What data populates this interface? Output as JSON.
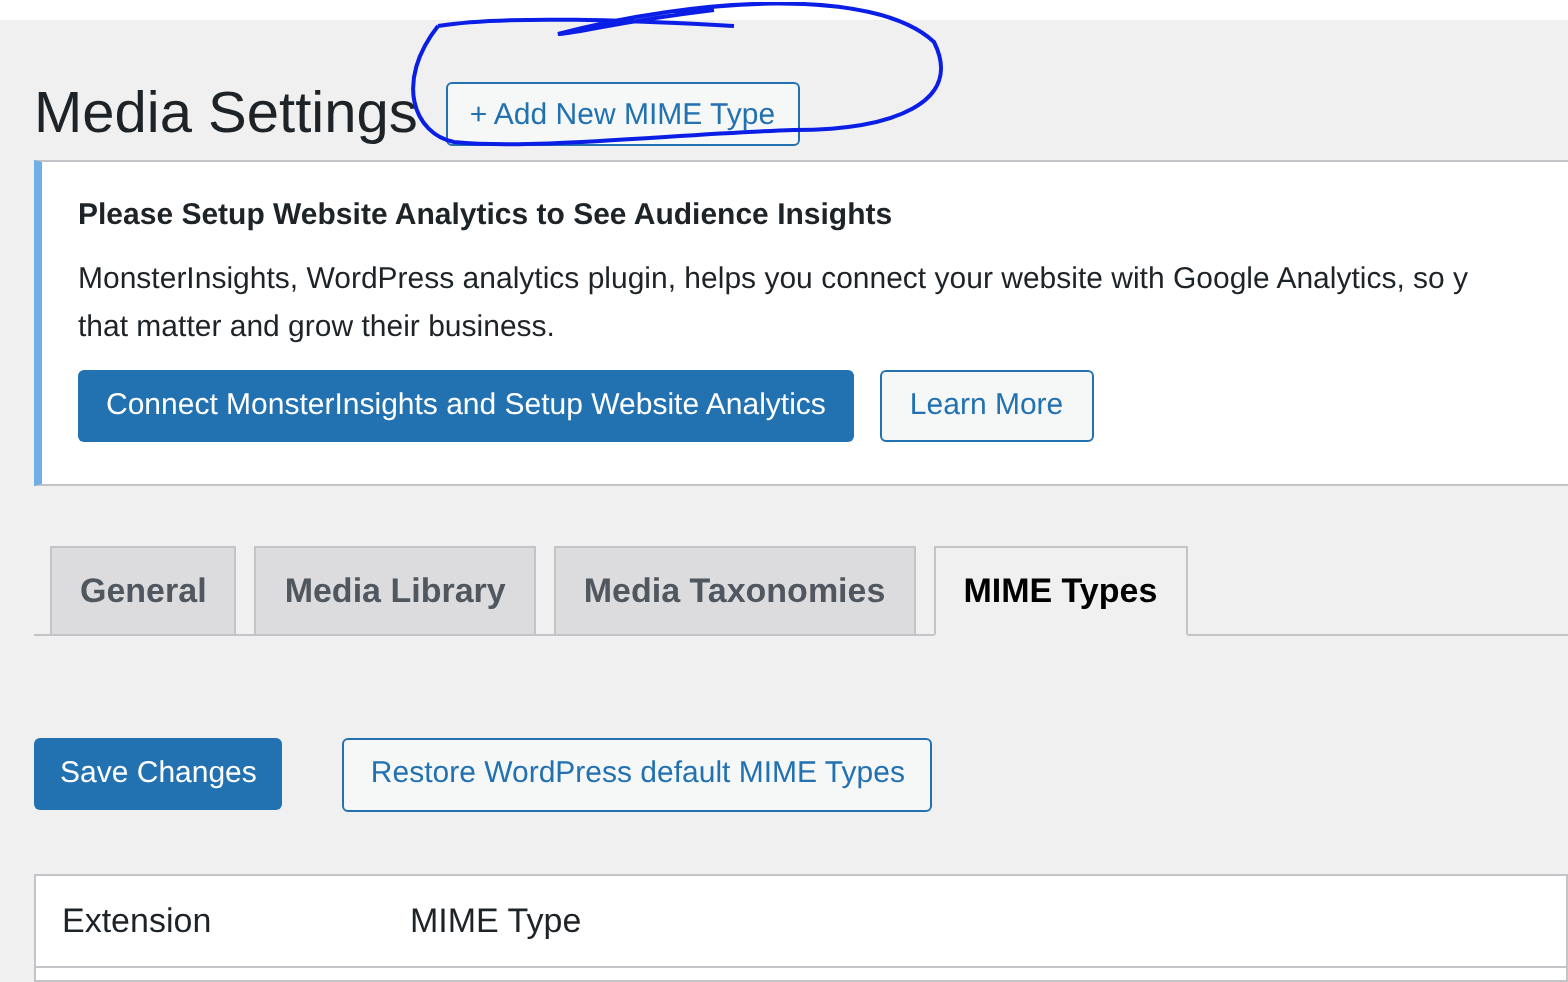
{
  "page_title": "Media Settings",
  "add_button": {
    "label": "+ Add New MIME Type",
    "circled": true
  },
  "notice": {
    "title": "Please Setup Website Analytics to See Audience Insights",
    "text": "MonsterInsights, WordPress analytics plugin, helps you connect your website with Google Analytics, so y",
    "text_line_2": "that matter and grow their business.",
    "primary_button": "Connect MonsterInsights and Setup Website Analytics",
    "secondary_button": "Learn More"
  },
  "tabs": [
    {
      "label": "General",
      "selected": false
    },
    {
      "label": "Media Library",
      "selected": false
    },
    {
      "label": "Media Taxonomies",
      "selected": false
    },
    {
      "label": "MIME Types",
      "selected": true
    }
  ],
  "save_button": "Save Changes",
  "restore_button": "Restore WordPress default MIME Types",
  "table": {
    "columns": [
      "Extension",
      "MIME Type"
    ]
  }
}
